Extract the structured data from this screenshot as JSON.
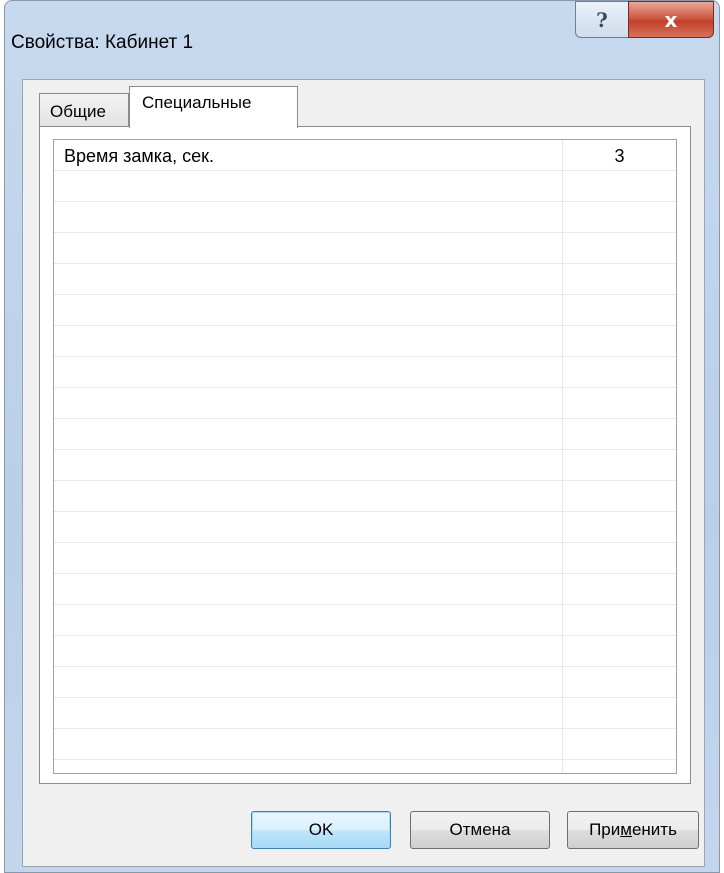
{
  "window": {
    "title": "Свойства: Кабинет 1",
    "help_glyph": "?",
    "close_glyph": "x"
  },
  "tabs": [
    {
      "label": "Общие",
      "selected": false
    },
    {
      "label": "Специальные",
      "selected": true
    }
  ],
  "properties": {
    "rows": [
      {
        "name": "Время замка, сек.",
        "value": "3"
      }
    ]
  },
  "buttons": {
    "ok": "OK",
    "cancel": "Отмена",
    "apply_pre": "При",
    "apply_accel": "м",
    "apply_post": "енить"
  },
  "icons": {
    "help": "help-icon",
    "close": "close-icon"
  },
  "colors": {
    "close_button": "#c7452f",
    "focused_button": "#3c7fb1",
    "window_frame": "#b9cfe8"
  }
}
